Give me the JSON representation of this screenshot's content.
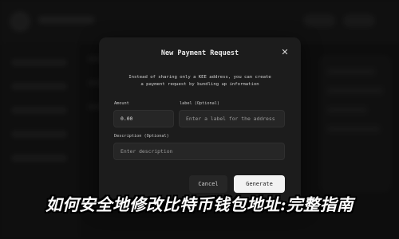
{
  "modal": {
    "title": "New Payment Request",
    "close_icon": "close-icon",
    "description_line1": "Instead of sharing only a KEE address, you can create",
    "description_line2": "a payment request by bundling up information",
    "amount_label": "Amount",
    "amount_value": "0.00",
    "label_label": "label (Optional)",
    "label_placeholder": "Enter a label for the address",
    "description_label": "Description (Optional)",
    "description_placeholder": "Enter description",
    "cancel_label": "Cancel",
    "generate_label": "Generate"
  },
  "caption": {
    "text": "如何安全地修改比特币钱包地址:完整指南"
  },
  "colors": {
    "modal_bg": "#1c1c1c",
    "primary_button": "#f2f2f2",
    "backdrop": "#151515"
  }
}
